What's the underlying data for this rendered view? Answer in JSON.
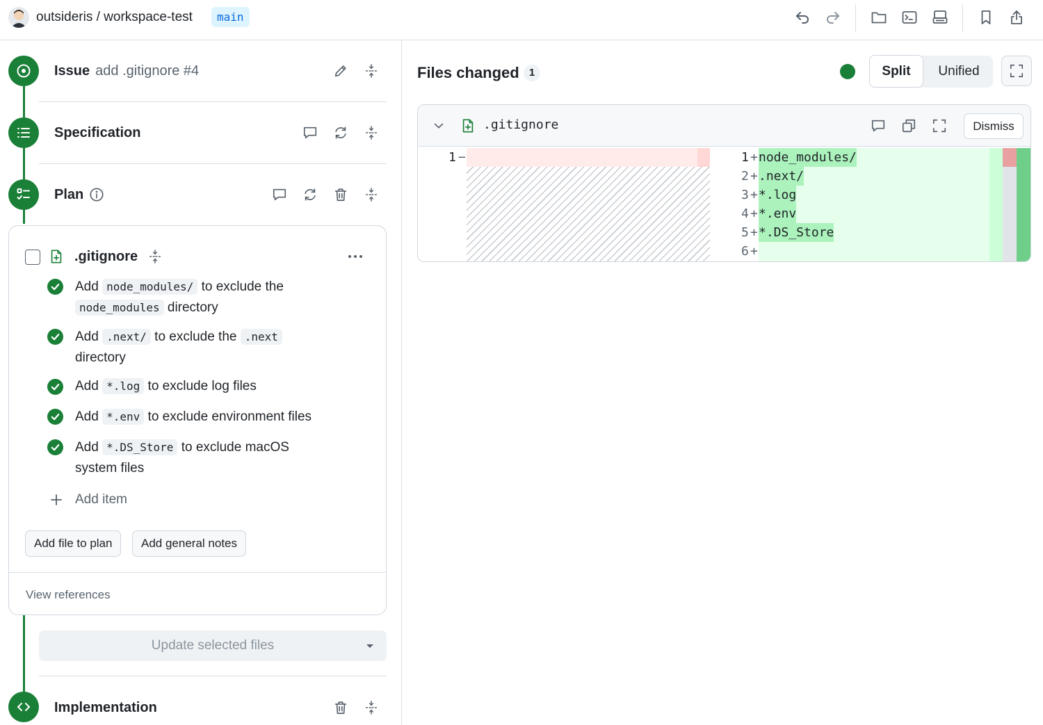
{
  "header": {
    "repo": "outsideris / workspace-test",
    "branch": "main"
  },
  "steps": {
    "issue": {
      "label": "Issue",
      "subtitle": "add .gitignore #4"
    },
    "specification": {
      "label": "Specification"
    },
    "plan": {
      "label": "Plan"
    },
    "implementation": {
      "label": "Implementation"
    }
  },
  "plan_card": {
    "file_name": ".gitignore",
    "items": [
      {
        "pre": "Add ",
        "code": "node_modules/",
        "mid": " to exclude the ",
        "code2": "node_modules",
        "post": " directory"
      },
      {
        "pre": "Add ",
        "code": ".next/",
        "mid": " to exclude the ",
        "code2": ".next",
        "post": " directory"
      },
      {
        "pre": "Add ",
        "code": "*.log",
        "mid": " to exclude log files",
        "code2": "",
        "post": ""
      },
      {
        "pre": "Add ",
        "code": "*.env",
        "mid": " to exclude environment files",
        "code2": "",
        "post": ""
      },
      {
        "pre": "Add ",
        "code": "*.DS_Store",
        "mid": " to exclude macOS system files",
        "code2": "",
        "post": ""
      }
    ],
    "add_item": "Add item",
    "add_file_button": "Add file to plan",
    "add_notes_button": "Add general notes",
    "view_references": "View references"
  },
  "update_button": "Update selected files",
  "files_changed": {
    "title": "Files changed",
    "count": "1",
    "view_split": "Split",
    "view_unified": "Unified"
  },
  "diff": {
    "file_name": ".gitignore",
    "dismiss": "Dismiss",
    "left_lines": [
      {
        "num": "1",
        "sign": "−",
        "text": ""
      }
    ],
    "right_lines": [
      {
        "num": "1",
        "sign": "+",
        "text": "node_modules/"
      },
      {
        "num": "2",
        "sign": "+",
        "text": ".next/"
      },
      {
        "num": "3",
        "sign": "+",
        "text": "*.log"
      },
      {
        "num": "4",
        "sign": "+",
        "text": "*.env"
      },
      {
        "num": "5",
        "sign": "+",
        "text": "*.DS_Store"
      },
      {
        "num": "6",
        "sign": "+",
        "text": ""
      }
    ]
  },
  "colors": {
    "accent_green": "#1a7f37",
    "added_bg": "#e6ffec",
    "added_highlight": "#abf2bc",
    "removed_bg": "#ffebe9",
    "branch_bg": "#ddf4ff",
    "branch_text": "#0969da"
  },
  "icons": [
    "undo-icon",
    "redo-icon",
    "folder-icon",
    "terminal-icon",
    "server-icon",
    "bookmark-icon",
    "share-icon",
    "pencil-icon",
    "drag-handle-icon",
    "comment-icon",
    "refresh-icon",
    "trash-icon",
    "info-icon",
    "file-added-icon",
    "more-icon",
    "check-icon",
    "plus-icon",
    "chevron-down-icon",
    "copy-icon",
    "fullscreen-icon",
    "target-icon",
    "list-icon",
    "checklist-icon",
    "code-icon"
  ]
}
